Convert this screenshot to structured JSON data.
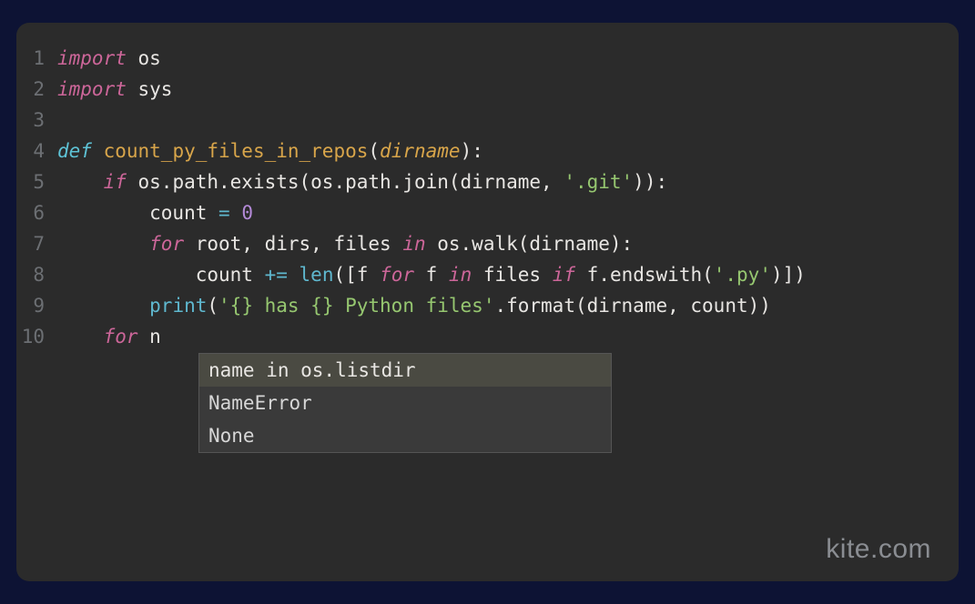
{
  "lines": [
    {
      "num": "1",
      "segments": [
        {
          "cls": "kw-import",
          "t": "import"
        },
        {
          "cls": "",
          "t": " "
        },
        {
          "cls": "attr",
          "t": "os"
        }
      ]
    },
    {
      "num": "2",
      "segments": [
        {
          "cls": "kw-import",
          "t": "import"
        },
        {
          "cls": "",
          "t": " "
        },
        {
          "cls": "attr",
          "t": "sys"
        }
      ]
    },
    {
      "num": "3",
      "segments": []
    },
    {
      "num": "4",
      "segments": [
        {
          "cls": "kw-def",
          "t": "def"
        },
        {
          "cls": "",
          "t": " "
        },
        {
          "cls": "fn-name",
          "t": "count_py_files_in_repos"
        },
        {
          "cls": "punct",
          "t": "("
        },
        {
          "cls": "param",
          "t": "dirname"
        },
        {
          "cls": "punct",
          "t": "):"
        }
      ]
    },
    {
      "num": "5",
      "segments": [
        {
          "cls": "",
          "t": "    "
        },
        {
          "cls": "kw-control",
          "t": "if"
        },
        {
          "cls": "",
          "t": " os.path.exists(os.path.join(dirname, "
        },
        {
          "cls": "string",
          "t": "'.git'"
        },
        {
          "cls": "",
          "t": ")):"
        }
      ]
    },
    {
      "num": "6",
      "segments": [
        {
          "cls": "",
          "t": "        count "
        },
        {
          "cls": "op",
          "t": "="
        },
        {
          "cls": "",
          "t": " "
        },
        {
          "cls": "number",
          "t": "0"
        }
      ]
    },
    {
      "num": "7",
      "segments": [
        {
          "cls": "",
          "t": "        "
        },
        {
          "cls": "kw-control",
          "t": "for"
        },
        {
          "cls": "",
          "t": " root, dirs, files "
        },
        {
          "cls": "kw-control",
          "t": "in"
        },
        {
          "cls": "",
          "t": " os.walk(dirname):"
        }
      ]
    },
    {
      "num": "8",
      "segments": [
        {
          "cls": "",
          "t": "            count "
        },
        {
          "cls": "op",
          "t": "+="
        },
        {
          "cls": "",
          "t": " "
        },
        {
          "cls": "builtin",
          "t": "len"
        },
        {
          "cls": "",
          "t": "([f "
        },
        {
          "cls": "kw-control",
          "t": "for"
        },
        {
          "cls": "",
          "t": " f "
        },
        {
          "cls": "kw-control",
          "t": "in"
        },
        {
          "cls": "",
          "t": " files "
        },
        {
          "cls": "kw-control",
          "t": "if"
        },
        {
          "cls": "",
          "t": " f.endswith("
        },
        {
          "cls": "string",
          "t": "'.py'"
        },
        {
          "cls": "",
          "t": ")])"
        }
      ]
    },
    {
      "num": "9",
      "segments": [
        {
          "cls": "",
          "t": "        "
        },
        {
          "cls": "builtin",
          "t": "print"
        },
        {
          "cls": "",
          "t": "("
        },
        {
          "cls": "string",
          "t": "'{} has {} Python files'"
        },
        {
          "cls": "",
          "t": ".format(dirname, count))"
        }
      ]
    },
    {
      "num": "10",
      "segments": [
        {
          "cls": "",
          "t": "    "
        },
        {
          "cls": "kw-control",
          "t": "for"
        },
        {
          "cls": "",
          "t": " n"
        }
      ]
    }
  ],
  "autocomplete": {
    "items": [
      {
        "label": "name in os.listdir",
        "selected": true
      },
      {
        "label": "NameError",
        "selected": false
      },
      {
        "label": "None",
        "selected": false
      }
    ]
  },
  "watermark": "kite.com"
}
